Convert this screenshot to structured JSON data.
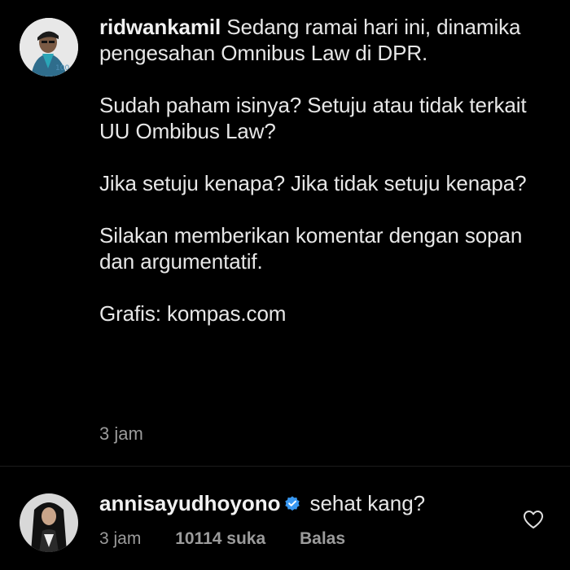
{
  "caption": {
    "username": "ridwankamil",
    "paragraphs": [
      "Sedang ramai hari ini, dinamika pengesahan Omnibus Law di DPR.",
      "Sudah paham isinya? Setuju atau tidak terkait UU Ombibus Law?",
      "Jika setuju kenapa? Jika tidak setuju kenapa?",
      "Silakan memberikan komentar dengan sopan dan argumentatif.",
      "Grafis: kompas.com"
    ],
    "time": "3 jam",
    "avatar_badge": "100"
  },
  "reply": {
    "username": "annisayudhoyono",
    "verified": true,
    "text": "sehat kang?",
    "time": "3 jam",
    "likes": "10114 suka",
    "reply_label": "Balas"
  },
  "icons": {
    "verified": "verified-badge-icon",
    "like": "heart-outline-icon"
  },
  "colors": {
    "background": "#000000",
    "text": "#e7e7e7",
    "meta": "#9b9b9b",
    "verified": "#3897f0"
  }
}
